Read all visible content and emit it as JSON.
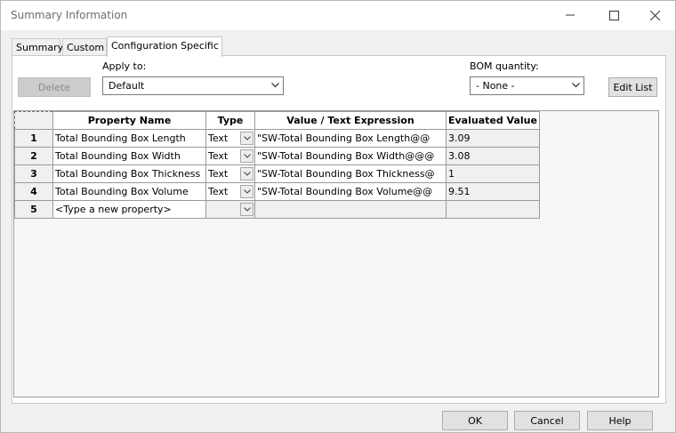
{
  "window": {
    "title": "Summary Information"
  },
  "tabs": [
    {
      "label": "Summary",
      "active": false
    },
    {
      "label": "Custom",
      "active": false
    },
    {
      "label": "Configuration Specific",
      "active": true
    }
  ],
  "toolbar": {
    "delete_label": "Delete",
    "apply_to_label": "Apply to:",
    "apply_to_value": "Default",
    "bom_label": "BOM quantity:",
    "bom_value": "- None -",
    "edit_list_label": "Edit List"
  },
  "grid": {
    "columns": [
      "Property Name",
      "Type",
      "Value / Text Expression",
      "Evaluated Value"
    ],
    "rows": [
      {
        "num": "1",
        "name": "Total Bounding Box Length",
        "type": "Text",
        "expr": "\"SW-Total Bounding Box Length@@",
        "value": "3.09"
      },
      {
        "num": "2",
        "name": "Total Bounding Box Width",
        "type": "Text",
        "expr": "\"SW-Total Bounding Box Width@@@",
        "value": "3.08"
      },
      {
        "num": "3",
        "name": "Total Bounding Box Thickness",
        "type": "Text",
        "expr": "\"SW-Total Bounding Box Thickness@",
        "value": "1"
      },
      {
        "num": "4",
        "name": "Total Bounding Box Volume",
        "type": "Text",
        "expr": "\"SW-Total Bounding Box Volume@@",
        "value": "9.51"
      },
      {
        "num": "5",
        "name": "<Type a new property>",
        "type": "",
        "expr": "",
        "value": ""
      }
    ]
  },
  "footer": {
    "ok_label": "OK",
    "cancel_label": "Cancel",
    "help_label": "Help"
  },
  "icons": {
    "minimize": "minimize-icon",
    "maximize": "maximize-icon",
    "close": "close-icon",
    "dropdown": "chevron-down-icon"
  }
}
